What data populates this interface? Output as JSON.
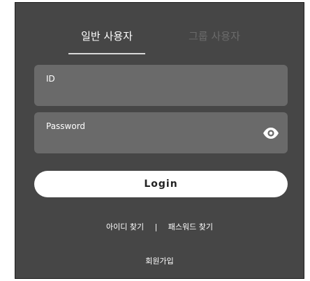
{
  "tabs": {
    "general_user": "일반 사용자",
    "group_user": "그룹 사용자"
  },
  "form": {
    "id_label": "ID",
    "password_label": "Password",
    "password_toggle_icon": "eye-icon",
    "login_label": "Login"
  },
  "links": {
    "find_id": "아이디 찾기",
    "separator": "|",
    "find_password": "패스워드 찾기",
    "signup": "회원가입"
  },
  "colors": {
    "panel_bg": "#464646",
    "field_bg": "#6a6a6a",
    "active_tab": "#ffffff",
    "inactive_tab": "#6b6b6b",
    "button_bg": "#ffffff"
  }
}
